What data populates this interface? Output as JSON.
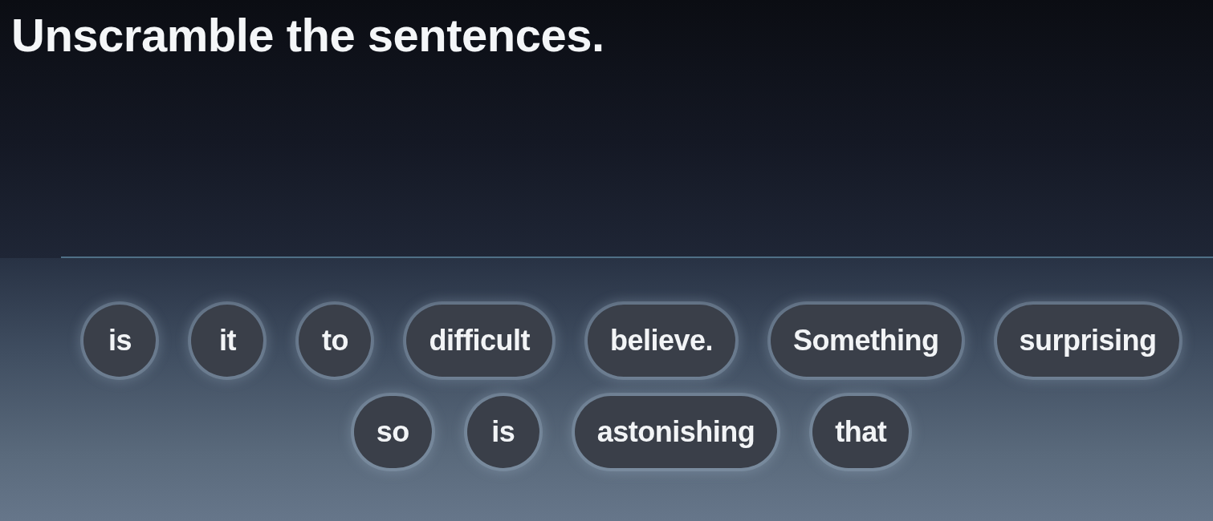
{
  "title": "Unscramble the sentences.",
  "word_bank": {
    "rows": [
      {
        "words": [
          "is",
          "it",
          "to",
          "difficult",
          "believe.",
          "Something",
          "surprising"
        ]
      },
      {
        "words": [
          "so",
          "is",
          "astonishing",
          "that"
        ]
      }
    ]
  }
}
